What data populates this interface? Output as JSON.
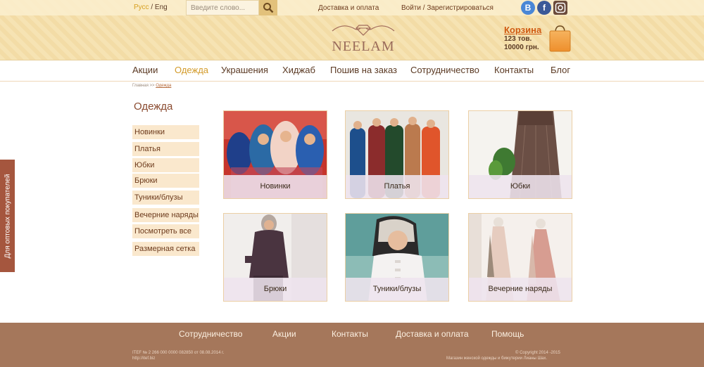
{
  "topbar": {
    "lang_ru": "Русс",
    "lang_sep": " / ",
    "lang_en": "Eng",
    "search_placeholder": "Введите слово...",
    "delivery": "Доставка и оплата",
    "auth": "Войти / Зарегистрироваться",
    "social": [
      "vk-icon",
      "facebook-icon",
      "instagram-icon"
    ]
  },
  "logo": {
    "name": "NEELAM"
  },
  "cart": {
    "title": "Корзина",
    "items": "123 тов.",
    "total": "10000 грн."
  },
  "nav": {
    "items": [
      "Акции",
      "Одежда",
      "Украшения",
      "Хиджаб",
      "Пошив на заказ",
      "Сотрудничество",
      "Контакты",
      "Блог"
    ],
    "active": "Одежда"
  },
  "breadcrumb": {
    "home": "Главная",
    "sep": " >> ",
    "current": "Одежда"
  },
  "section_title": "Одежда",
  "sidebar": {
    "items": [
      "Новинки",
      "Платья",
      "Юбки",
      "Брюки",
      "Туники/блузы",
      "Вечерние наряды",
      "Посмотреть все",
      "Размерная сетка"
    ]
  },
  "side_tab": "Для оптовых покупателей",
  "products": [
    "Новинки",
    "Платья",
    "Юбки",
    "Брюки",
    "Туники/блузы",
    "Вечерние наряды"
  ],
  "footer": {
    "links": [
      "Сотрудничество",
      "Акции",
      "Контакты",
      "Доставка и оплата",
      "Помощь"
    ],
    "reg_line1": "ITEF  № 2 266 000 0000 082850 от 08.08.2014 г.",
    "reg_line2": "http://itef.biz",
    "copyright1": "© Copyright 2014 -2015",
    "copyright2": "Магазин женской одежды и бижутерии Лианы Шах."
  },
  "colors": {
    "accent": "#d39b2a",
    "brand_brown": "#5b3a24",
    "footer": "#a5775b",
    "side_tab": "#a5563e"
  }
}
